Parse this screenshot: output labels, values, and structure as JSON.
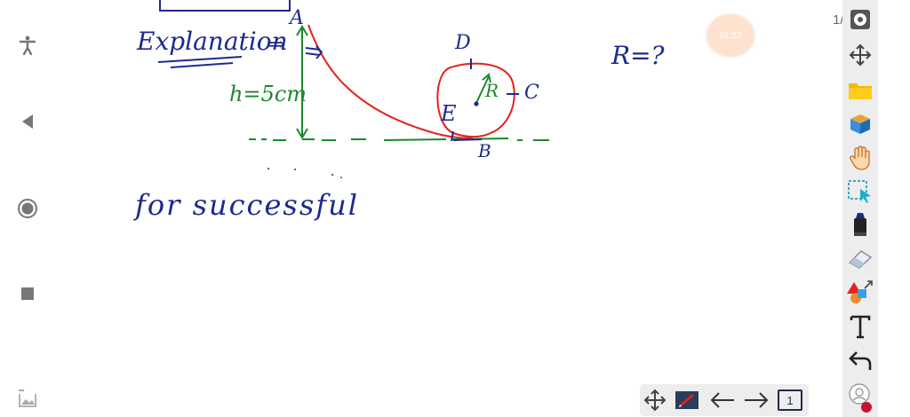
{
  "board": {
    "heading": "Explanation",
    "arrow_symbol": "⇒",
    "height_label": "h=5cm",
    "point_a": "A",
    "point_b": "B",
    "point_c": "C",
    "point_d": "D",
    "point_e": "E",
    "radius_label": "R",
    "question": "R=?",
    "note": "for successful"
  },
  "timer": {
    "value": "01:52"
  },
  "page_indicator": "1/",
  "bottom_bar": {
    "page_number": "1"
  },
  "icons": {
    "nav": [
      "accessibility-icon",
      "back-icon",
      "home-icon",
      "recents-icon",
      "gallery-icon"
    ],
    "tools": [
      "settings-icon",
      "move-icon",
      "folder-icon",
      "cube-icon",
      "hand-icon",
      "select-icon",
      "marker-icon",
      "eraser-icon",
      "shapes-icon",
      "text-icon",
      "undo-icon",
      "assistant-icon"
    ]
  },
  "colors": {
    "ink_blue": "#1c2a8c",
    "ink_red": "#e3231f",
    "ink_green": "#1a8a2a",
    "toolbar_bg": "#ededed",
    "timer_bg": "#fde3cf"
  }
}
